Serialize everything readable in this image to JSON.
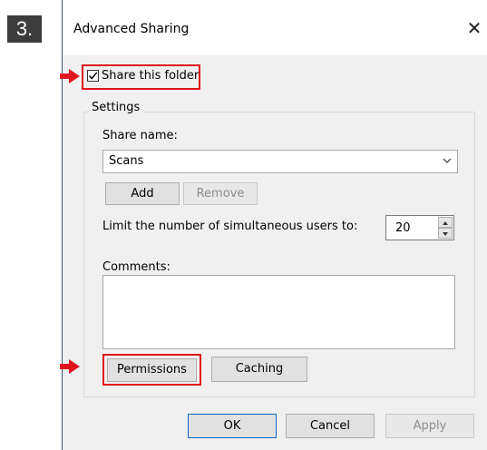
{
  "step": {
    "number": "3."
  },
  "dialog": {
    "title": "Advanced Sharing",
    "share_checkbox": {
      "label": "Share this folder",
      "checked": true
    },
    "settings": {
      "group_label": "Settings",
      "share_name_label": "Share name:",
      "share_name_value": "Scans",
      "add_label": "Add",
      "remove_label": "Remove",
      "limit_label": "Limit the number of simultaneous users to:",
      "limit_value": "20",
      "comments_label": "Comments:",
      "comments_value": "",
      "permissions_label": "Permissions",
      "caching_label": "Caching"
    },
    "footer": {
      "ok_label": "OK",
      "cancel_label": "Cancel",
      "apply_label": "Apply"
    }
  },
  "colors": {
    "highlight": "#e0141e",
    "title_border": "#3a5a84",
    "badge": "#3c3c3c"
  },
  "icons": [
    "close-icon",
    "checkmark-icon",
    "chevron-down-icon",
    "spin-up-icon",
    "spin-down-icon",
    "arrow-right-icon"
  ]
}
